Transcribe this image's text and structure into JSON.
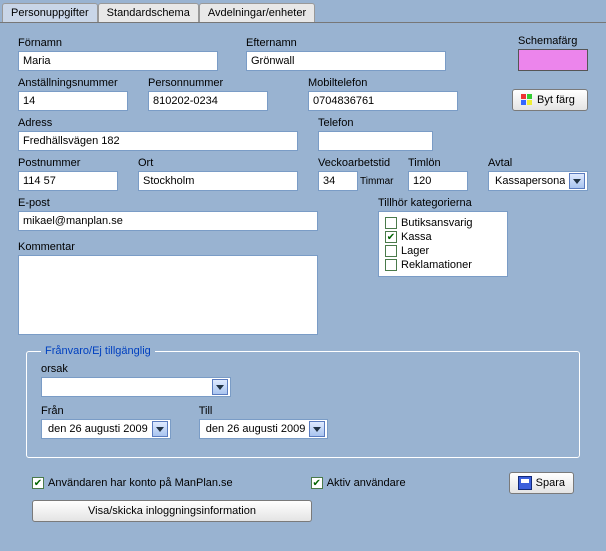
{
  "tabs": {
    "personuppgifter": "Personuppgifter",
    "standardschema": "Standardschema",
    "avdelningar": "Avdelningar/enheter"
  },
  "labels": {
    "fornamn": "Förnamn",
    "efternamn": "Efternamn",
    "schemafarg": "Schemafärg",
    "bytfarg": "Byt färg",
    "anstallningsnummer": "Anställningsnummer",
    "personnummer": "Personnummer",
    "mobiltelefon": "Mobiltelefon",
    "adress": "Adress",
    "telefon": "Telefon",
    "postnummer": "Postnummer",
    "ort": "Ort",
    "veckoarbetstid": "Veckoarbetstid",
    "timmar": "Timmar",
    "timlon": "Timlön",
    "avtal": "Avtal",
    "epost": "E-post",
    "tillhor": "Tillhör kategorierna",
    "kommentar": "Kommentar",
    "franvaro_legend": "Frånvaro/Ej tillgänglig",
    "orsak": "orsak",
    "fran": "Från",
    "till": "Till",
    "anv_konto": "Användaren har konto på ManPlan.se",
    "aktiv": "Aktiv användare",
    "spara": "Spara",
    "visa_skicka": "Visa/skicka inloggningsinformation"
  },
  "values": {
    "fornamn": "Maria",
    "efternamn": "Grönwall",
    "anstallningsnummer": "14",
    "personnummer": "810202-0234",
    "mobiltelefon": "0704836761",
    "adress": "Fredhällsvägen 182",
    "telefon": "",
    "postnummer": "114 57",
    "ort": "Stockholm",
    "veckoarbetstid": "34",
    "timlon": "120",
    "avtal": "Kassapersonal",
    "epost": "mikael@manplan.se",
    "kommentar": "",
    "orsak": "",
    "fran_display": "den 26   augusti   2009",
    "till_display": "den 26   augusti   2009",
    "anv_konto_checked": true,
    "aktiv_checked": true,
    "schemafarg_color": "#ec85ec"
  },
  "categories": [
    {
      "name": "Butiksansvarig",
      "checked": false
    },
    {
      "name": "Kassa",
      "checked": true
    },
    {
      "name": "Lager",
      "checked": false
    },
    {
      "name": "Reklamationer",
      "checked": false
    }
  ]
}
